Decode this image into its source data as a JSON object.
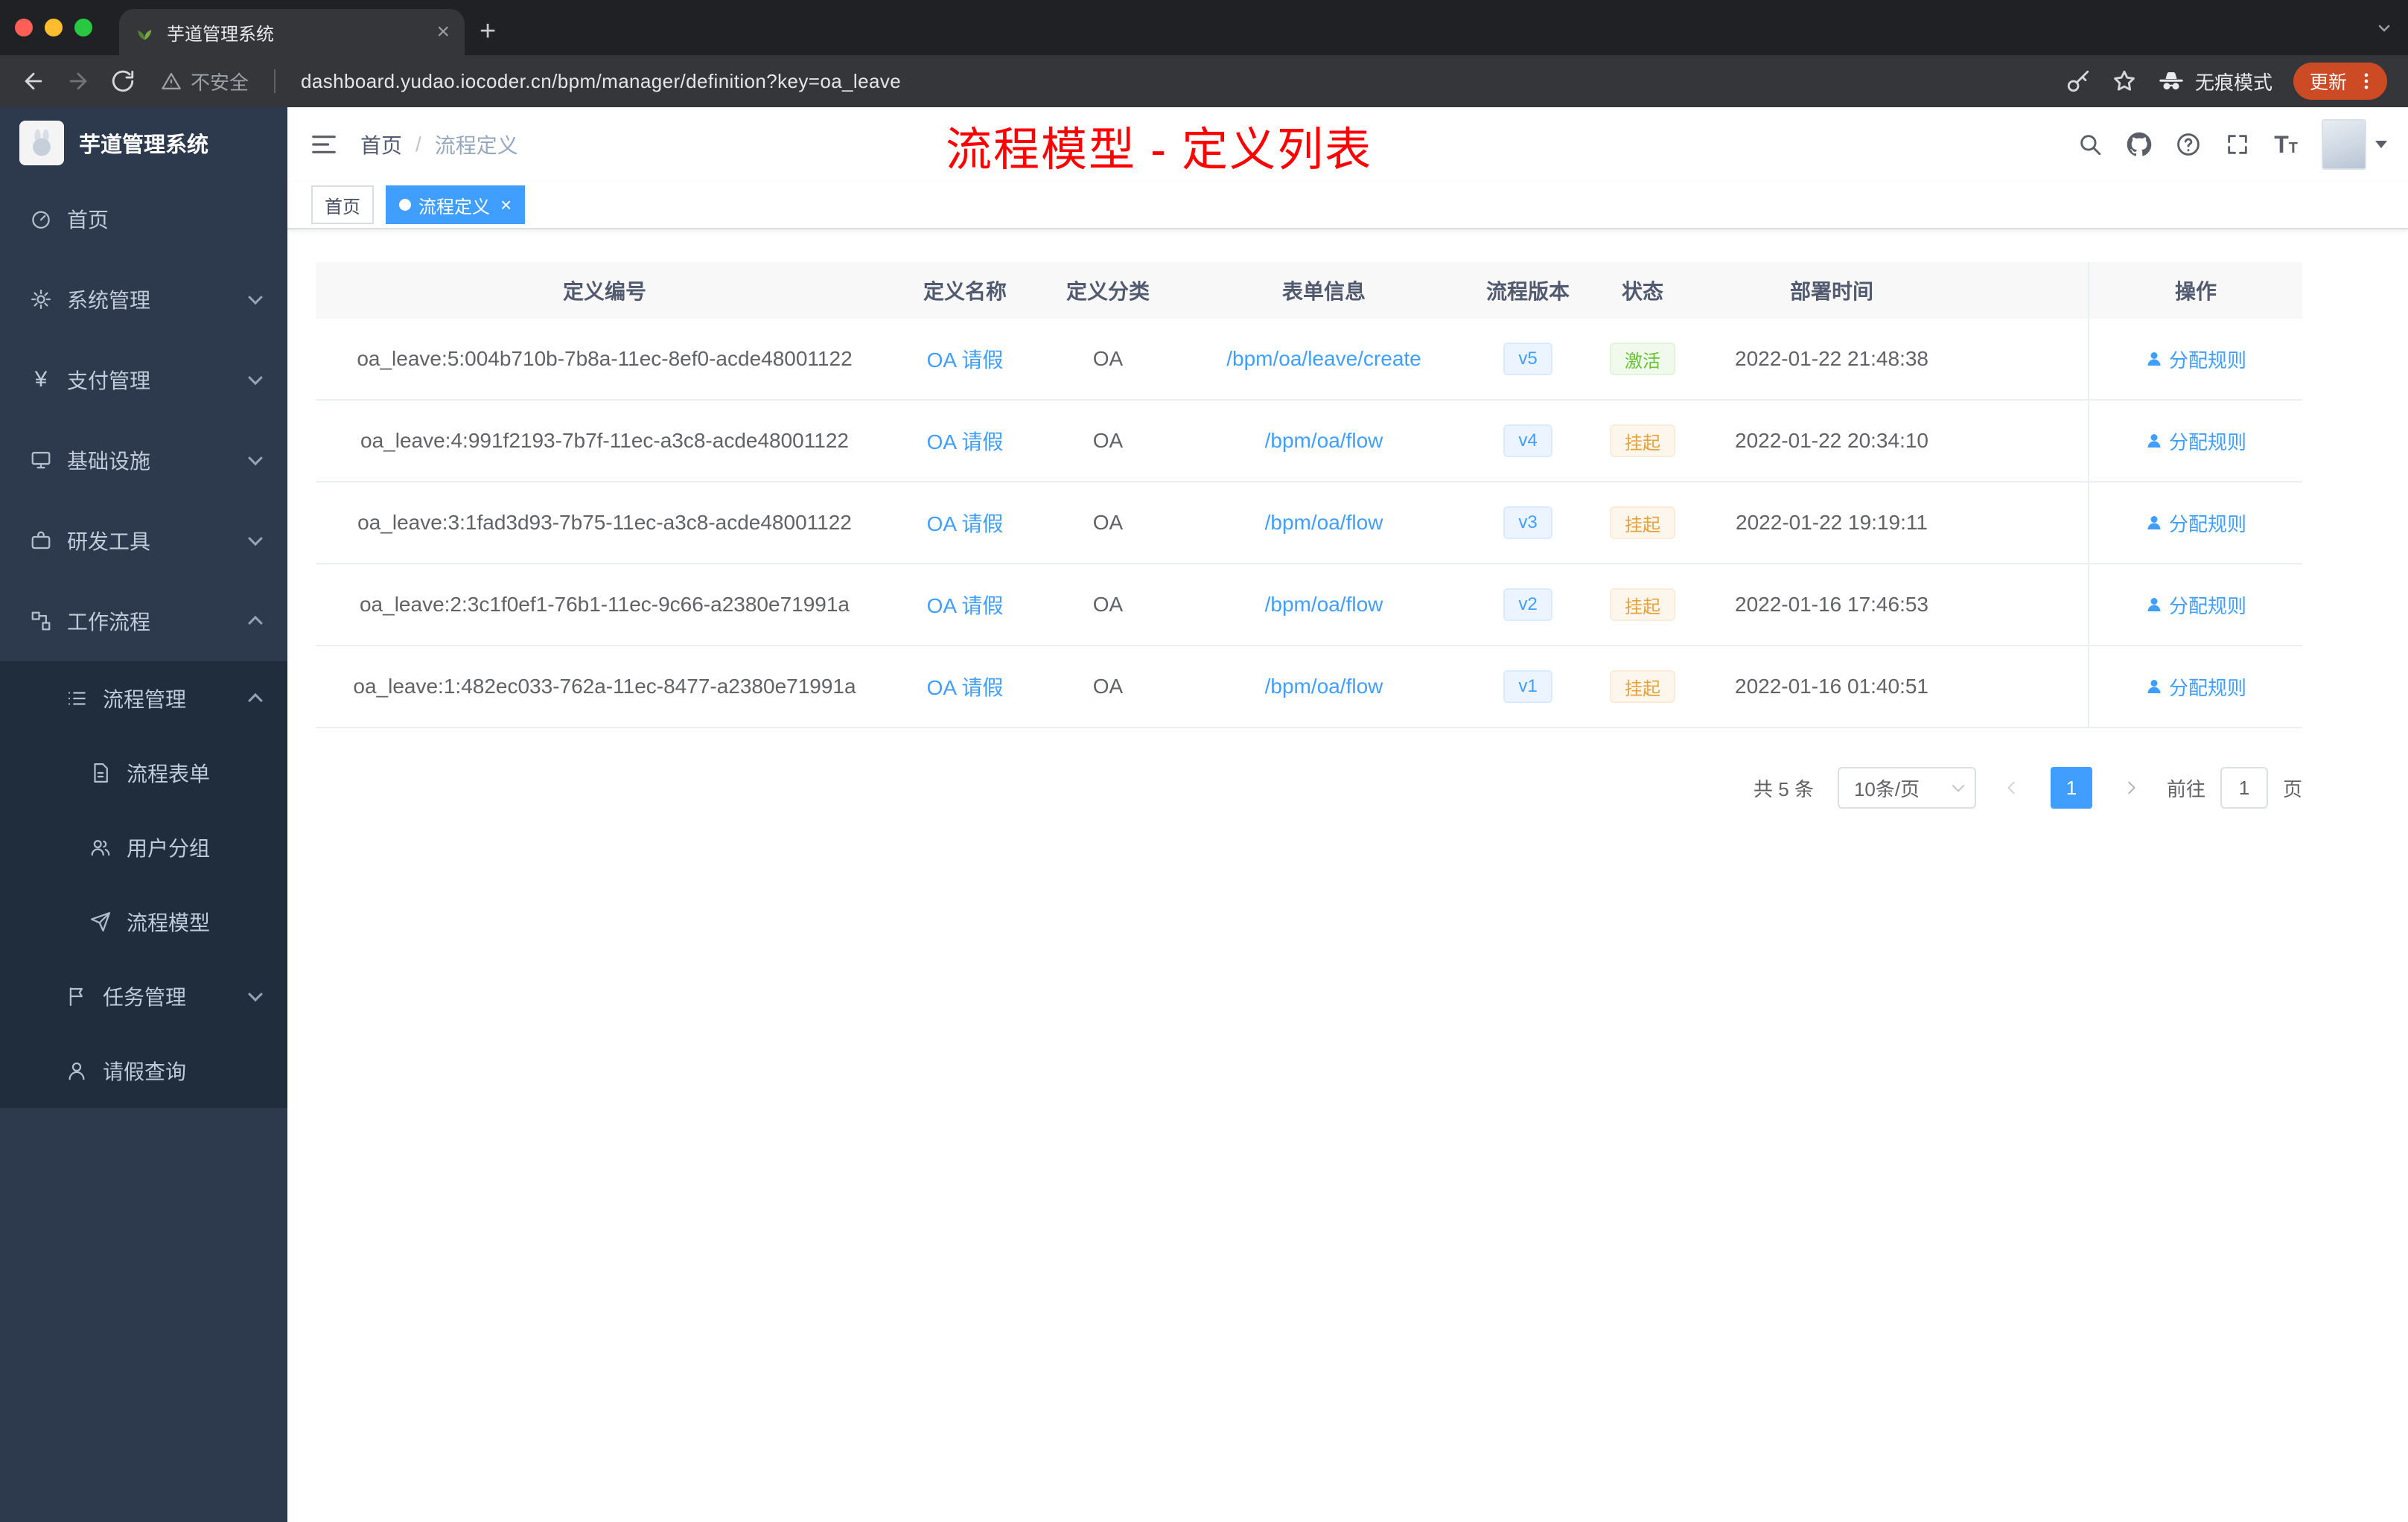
{
  "browser": {
    "tab_title": "芋道管理系统",
    "security_label": "不安全",
    "url": "dashboard.yudao.iocoder.cn/bpm/manager/definition?key=oa_leave",
    "incognito_label": "无痕模式",
    "update_label": "更新"
  },
  "sidebar": {
    "logo_title": "芋道管理系统",
    "menu": [
      {
        "label": "首页"
      },
      {
        "label": "系统管理"
      },
      {
        "label": "支付管理"
      },
      {
        "label": "基础设施"
      },
      {
        "label": "研发工具"
      },
      {
        "label": "工作流程"
      },
      {
        "label": "流程管理"
      },
      {
        "label": "流程表单"
      },
      {
        "label": "用户分组"
      },
      {
        "label": "流程模型"
      },
      {
        "label": "任务管理"
      },
      {
        "label": "请假查询"
      }
    ]
  },
  "header": {
    "breadcrumb": [
      "首页",
      "流程定义"
    ],
    "breadcrumb_separator": "/",
    "annotation": "流程模型 - 定义列表"
  },
  "tags": [
    {
      "label": "首页"
    },
    {
      "label": "流程定义"
    }
  ],
  "table": {
    "headers": [
      "定义编号",
      "定义名称",
      "定义分类",
      "表单信息",
      "流程版本",
      "状态",
      "部署时间",
      "操作"
    ],
    "rows": [
      {
        "id": "oa_leave:5:004b710b-7b8a-11ec-8ef0-acde48001122",
        "name": "OA 请假",
        "category": "OA",
        "form": "/bpm/oa/leave/create",
        "version": "v5",
        "status": "激活",
        "deploy_time": "2022-01-22 21:48:38",
        "action": "分配规则"
      },
      {
        "id": "oa_leave:4:991f2193-7b7f-11ec-a3c8-acde48001122",
        "name": "OA 请假",
        "category": "OA",
        "form": "/bpm/oa/flow",
        "version": "v4",
        "status": "挂起",
        "deploy_time": "2022-01-22 20:34:10",
        "action": "分配规则"
      },
      {
        "id": "oa_leave:3:1fad3d93-7b75-11ec-a3c8-acde48001122",
        "name": "OA 请假",
        "category": "OA",
        "form": "/bpm/oa/flow",
        "version": "v3",
        "status": "挂起",
        "deploy_time": "2022-01-22 19:19:11",
        "action": "分配规则"
      },
      {
        "id": "oa_leave:2:3c1f0ef1-76b1-11ec-9c66-a2380e71991a",
        "name": "OA 请假",
        "category": "OA",
        "form": "/bpm/oa/flow",
        "version": "v2",
        "status": "挂起",
        "deploy_time": "2022-01-16 17:46:53",
        "action": "分配规则"
      },
      {
        "id": "oa_leave:1:482ec033-762a-11ec-8477-a2380e71991a",
        "name": "OA 请假",
        "category": "OA",
        "form": "/bpm/oa/flow",
        "version": "v1",
        "status": "挂起",
        "deploy_time": "2022-01-16 01:40:51",
        "action": "分配规则"
      }
    ]
  },
  "pagination": {
    "total": "共 5 条",
    "page_size": "10条/页",
    "current_page": "1",
    "goto_prefix": "前往",
    "goto_value": "1",
    "goto_suffix": "页"
  },
  "colors": {
    "accent": "#409eff",
    "sidebar_bg": "#2d3a4d",
    "submenu_bg": "#1f2d3d",
    "status_active": "#67c23a",
    "status_suspended": "#e6a23c",
    "annotation_red": "#ff0000",
    "update_pill": "#cc4a24"
  }
}
